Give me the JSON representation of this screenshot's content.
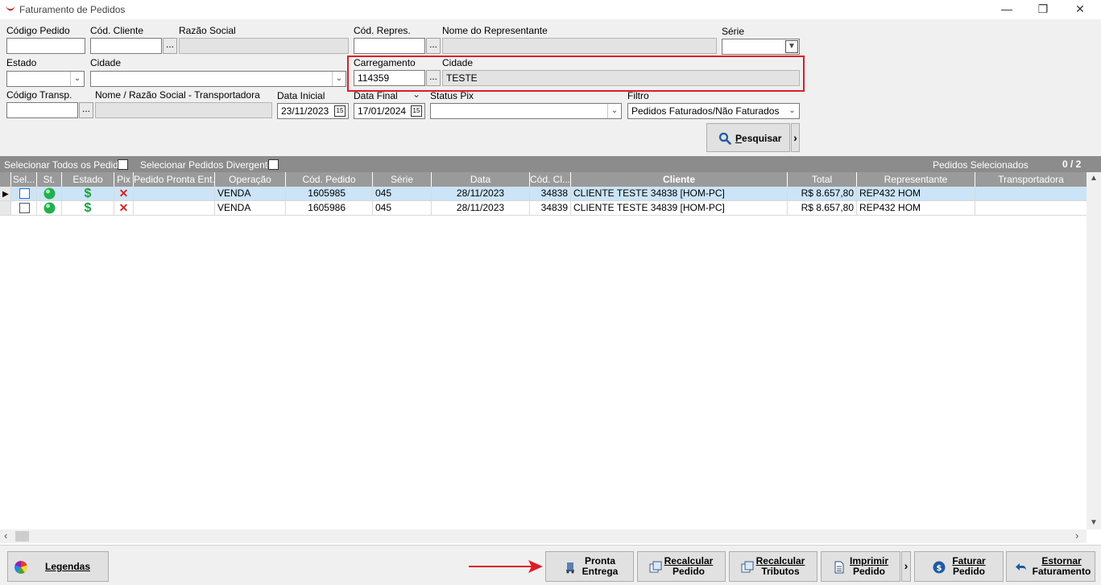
{
  "window": {
    "title": "Faturamento de Pedidos",
    "minimize": "—",
    "maximize": "❐",
    "close": "✕"
  },
  "filters": {
    "codigo_pedido_label": "Código Pedido",
    "codigo_pedido_value": "",
    "cod_cliente_label": "Cód. Cliente",
    "cod_cliente_value": "",
    "razao_social_label": "Razão Social",
    "razao_social_value": "",
    "cod_repres_label": "Cód. Repres.",
    "cod_repres_value": "",
    "nome_representante_label": "Nome do Representante",
    "nome_representante_value": "",
    "serie_label": "Série",
    "serie_value": "",
    "estado_label": "Estado",
    "estado_value": "",
    "cidade_label": "Cidade",
    "cidade_value": "",
    "carregamento_label": "Carregamento",
    "carregamento_value": "114359",
    "carregamento_cidade_label": "Cidade",
    "carregamento_cidade_value": "TESTE",
    "codigo_transp_label": "Código Transp.",
    "codigo_transp_value": "",
    "nome_transportadora_label": "Nome / Razão Social - Transportadora",
    "nome_transportadora_value": "",
    "data_inicial_label": "Data Inicial",
    "data_inicial_value": "23/11/2023",
    "data_final_label": "Data Final",
    "data_final_value": "17/01/2024",
    "status_pix_label": "Status Pix",
    "status_pix_value": "",
    "filtro_label": "Filtro",
    "filtro_value": "Pedidos Faturados/Não Faturados",
    "dots": "...",
    "calendar": "15"
  },
  "search_button": {
    "underline": "P",
    "rest": "esquisar",
    "more": "›"
  },
  "selection_bar": {
    "select_all": "Selecionar Todos os Pedidos",
    "select_divergent": "Selecionar Pedidos Divergentes",
    "selected_label": "Pedidos Selecionados",
    "selected_count": "0 / 2"
  },
  "grid": {
    "columns": [
      "Sel...",
      "St.",
      "Estado",
      "Pix",
      "Pedido Pronta Ent...",
      "Operação",
      "Cód. Pedido",
      "Série",
      "Data",
      "Cód. Cl...",
      "Cliente",
      "Total",
      "Representante",
      "Transportadora"
    ],
    "rows": [
      {
        "operacao": "VENDA",
        "cod_pedido": "1605985",
        "serie": "045",
        "data": "28/11/2023",
        "cod_cliente": "34838",
        "cliente": "CLIENTE TESTE 34838 [HOM-PC]",
        "total": "R$ 8.657,80",
        "representante": "REP432 HOM",
        "transportadora": "",
        "selected": false,
        "highlighted": true
      },
      {
        "operacao": "VENDA",
        "cod_pedido": "1605986",
        "serie": "045",
        "data": "28/11/2023",
        "cod_cliente": "34839",
        "cliente": "CLIENTE TESTE 34839 [HOM-PC]",
        "total": "R$ 8.657,80",
        "representante": "REP432 HOM",
        "transportadora": "",
        "selected": false,
        "highlighted": false
      }
    ]
  },
  "bottom": {
    "legendas": "Legendas",
    "pronta_l1": "Pronta",
    "pronta_l2": "Entrega",
    "recalc_pedido_l1": "Recalcular",
    "recalc_pedido_l2": "Pedido",
    "recalc_trib_l1": "Recalcular",
    "recalc_trib_l2": "Tributos",
    "imprimir_l1": "Imprimir",
    "imprimir_l2": "Pedido",
    "more": "›",
    "faturar_l1": "Faturar",
    "faturar_l2": "Pedido",
    "estornar_l1": "Estornar",
    "estornar_l2": "Faturamento"
  },
  "colors": {
    "accent_red": "#e01b24",
    "row_highlight": "#cce4f7",
    "status_green": "#22b14c",
    "money_green": "#19a13d"
  }
}
